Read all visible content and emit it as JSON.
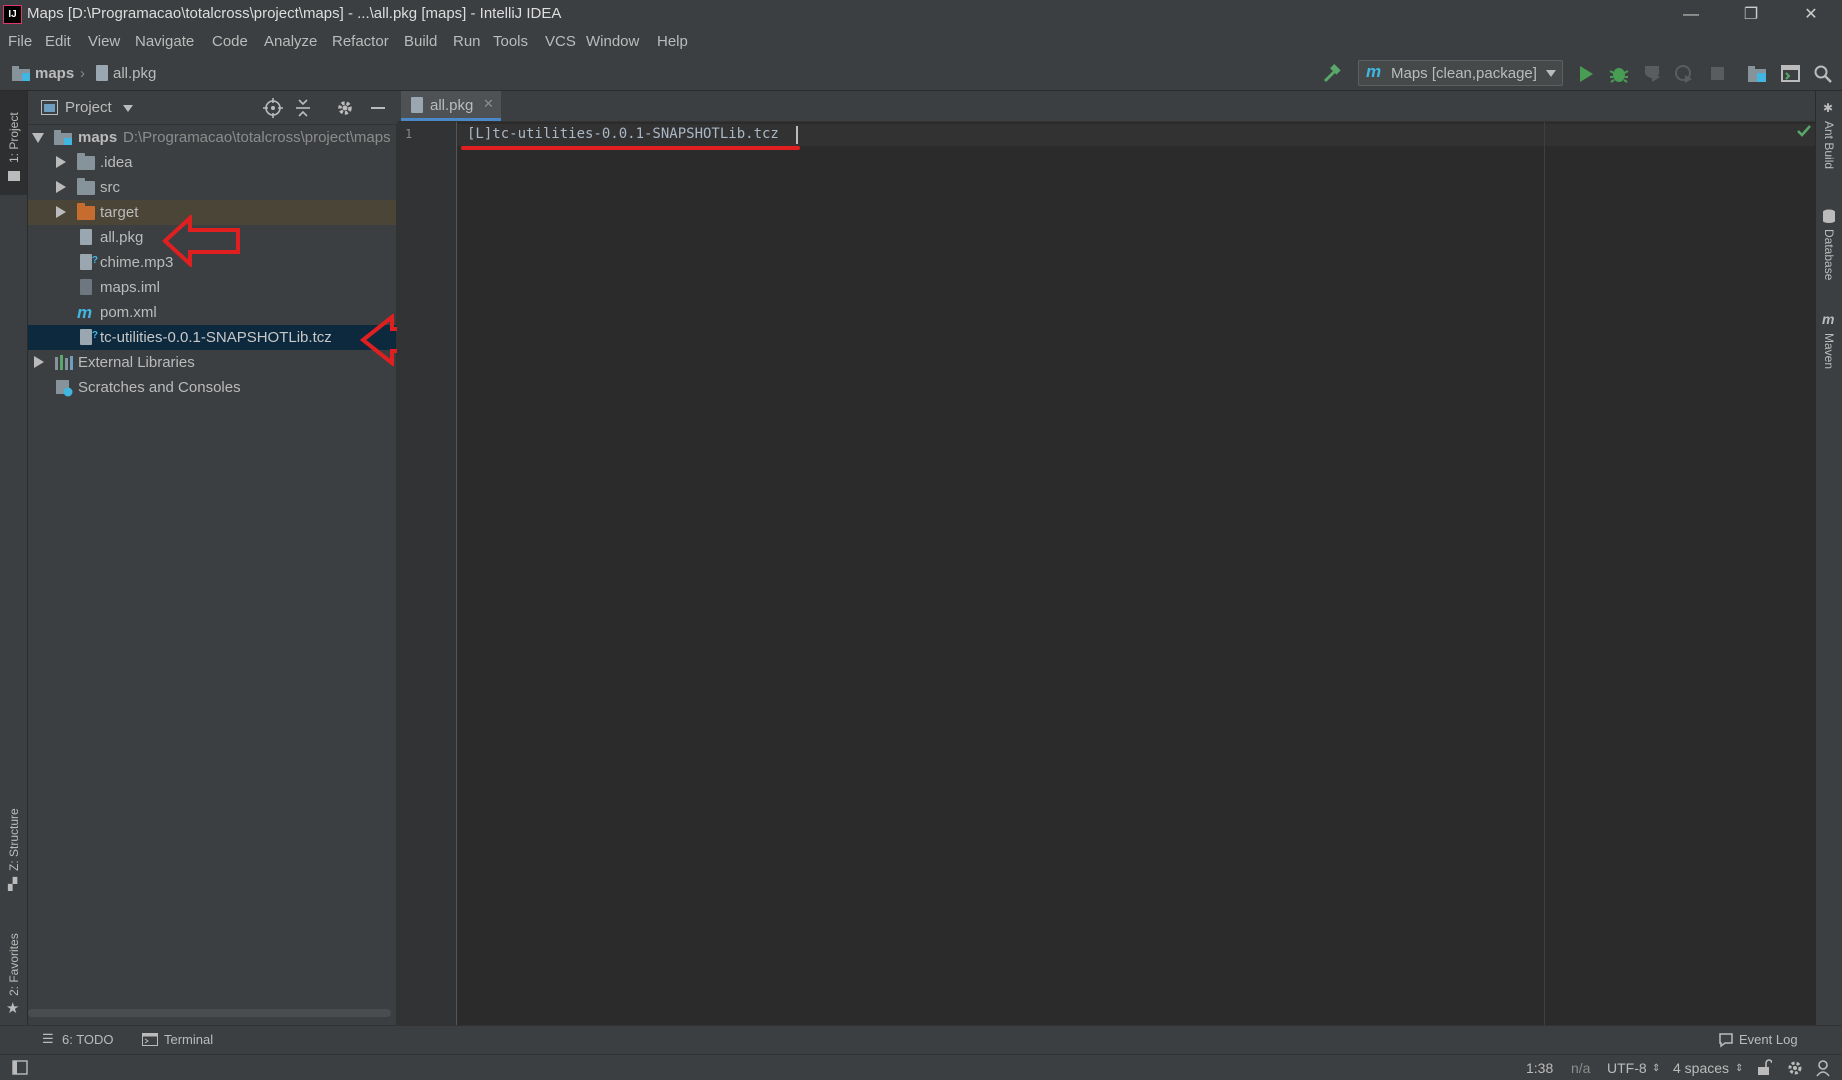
{
  "window": {
    "title": "Maps [D:\\Programacao\\totalcross\\project\\maps] - ...\\all.pkg [maps] - IntelliJ IDEA",
    "app_icon_text": "IJ",
    "minimize": "—",
    "restore": "❐",
    "close": "✕"
  },
  "menu": [
    "File",
    "Edit",
    "View",
    "Navigate",
    "Code",
    "Analyze",
    "Refactor",
    "Build",
    "Run",
    "Tools",
    "VCS",
    "Window",
    "Help"
  ],
  "breadcrumb": {
    "project": "maps",
    "file": "all.pkg"
  },
  "toolbar": {
    "run_config": "Maps [clean,package]",
    "run_config_icon": "m",
    "icons": [
      "hammer-icon",
      "run-icon",
      "debug-icon",
      "coverage-icon",
      "profile-icon",
      "stop-icon",
      "project-structure-icon",
      "terminal-layout-icon",
      "search-icon"
    ]
  },
  "left_stripe": {
    "project_tab": "1: Project",
    "structure_tab": "Z: Structure",
    "favorites_tab": "2: Favorites"
  },
  "right_stripe": {
    "ant": "Ant Build",
    "database": "Database",
    "maven": "Maven"
  },
  "project_panel": {
    "title": "Project",
    "tree": [
      {
        "label": "maps",
        "path": "D:\\Programacao\\totalcross\\project\\maps",
        "type": "module",
        "expanded": true,
        "depth": 0
      },
      {
        "label": ".idea",
        "type": "folder",
        "depth": 1
      },
      {
        "label": "src",
        "type": "folder",
        "depth": 1
      },
      {
        "label": "target",
        "type": "folder-excluded",
        "depth": 1
      },
      {
        "label": "all.pkg",
        "type": "file",
        "depth": 1
      },
      {
        "label": "chime.mp3",
        "type": "file-unknown",
        "depth": 1
      },
      {
        "label": "maps.iml",
        "type": "file-iml",
        "depth": 1
      },
      {
        "label": "pom.xml",
        "type": "maven",
        "depth": 1
      },
      {
        "label": "tc-utilities-0.0.1-SNAPSHOTLib.tcz",
        "type": "file-unknown",
        "depth": 1,
        "selected": true
      },
      {
        "label": "External Libraries",
        "type": "libraries",
        "depth": 0
      },
      {
        "label": "Scratches and Consoles",
        "type": "scratches",
        "depth": 0
      }
    ]
  },
  "editor": {
    "tab_label": "all.pkg",
    "line_numbers": [
      "1"
    ],
    "lines": [
      "[L]tc-utilities-0.0.1-SNAPSHOTLib.tcz"
    ]
  },
  "bottom_tools": {
    "todo": "6: TODO",
    "terminal": "Terminal",
    "event_log": "Event Log"
  },
  "status": {
    "position": "1:38",
    "na": "n/a",
    "encoding": "UTF-8",
    "indent": "4 spaces"
  },
  "colors": {
    "annotation_red": "#e02020",
    "accent_blue": "#4a88c7",
    "selection": "#0d293e"
  }
}
